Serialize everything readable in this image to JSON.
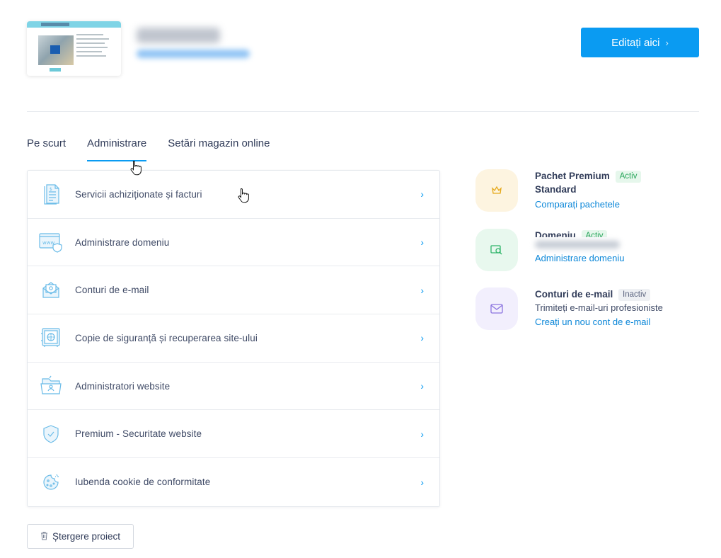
{
  "header": {
    "edit_label": "Editați aici",
    "edit_chevron": "›"
  },
  "tabs": [
    {
      "label": "Pe scurt",
      "active": false
    },
    {
      "label": "Administrare",
      "active": true
    },
    {
      "label": "Setări magazin online",
      "active": false
    }
  ],
  "admin_list": [
    {
      "label": "Servicii achiziționate și facturi",
      "icon": "invoice-icon"
    },
    {
      "label": "Administrare domeniu",
      "icon": "domain-www-icon"
    },
    {
      "label": "Conturi de e-mail",
      "icon": "email-icon"
    },
    {
      "label": "Copie de siguranță și recuperarea site-ului",
      "icon": "safe-backup-icon"
    },
    {
      "label": "Administratori website",
      "icon": "folder-user-icon"
    },
    {
      "label": "Premium - Securitate website",
      "icon": "shield-check-icon"
    },
    {
      "label": "Iubenda cookie de conformitate",
      "icon": "cookie-icon"
    }
  ],
  "row_arrow": "›",
  "status": {
    "package": {
      "title": "Pachet Premium",
      "badge": "Activ",
      "subtitle": "Standard",
      "link": "Comparați pachetele",
      "icon": "crown-icon",
      "color": "#fdf4e0"
    },
    "domain": {
      "title": "Domeniu",
      "badge": "Activ",
      "link": "Administrare domeniu",
      "icon": "domain-search-icon",
      "color": "#e8f8ee"
    },
    "email": {
      "title": "Conturi de e-mail",
      "badge": "Inactiv",
      "subtitle": "Trimiteți e-mail-uri profesioniste",
      "link": "Creați un nou cont de e-mail",
      "icon": "envelope-icon",
      "color": "#f2effd"
    }
  },
  "delete_label": "Ștergere proiect",
  "colors": {
    "accent": "#0a9bf2",
    "text": "#313c59",
    "active_badge": "#27a55a"
  }
}
